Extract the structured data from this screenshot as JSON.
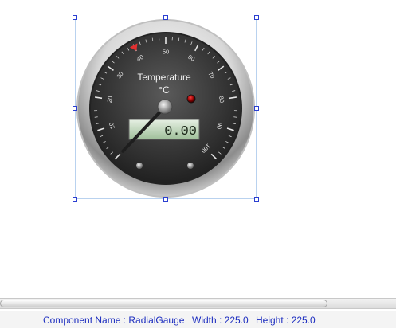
{
  "gauge": {
    "title": "Temperature",
    "unit": "°C",
    "min": 0,
    "max": 100,
    "major_step": 10,
    "value": 0,
    "display": "0.00",
    "warning_marker_value": 40,
    "colors": {
      "face": "#3a3a3a",
      "ticks": "#e6e6e6",
      "lcd": "#b9d1b5",
      "warning": "#e03030",
      "led": "#8a0000"
    }
  },
  "status": {
    "component_label": "Component Name : RadialGauge",
    "width_label": "Width : 225.0",
    "height_label": "Height : 225.0"
  },
  "icons": [
    "resize-handle-icon",
    "led-icon",
    "warning-marker-icon"
  ]
}
